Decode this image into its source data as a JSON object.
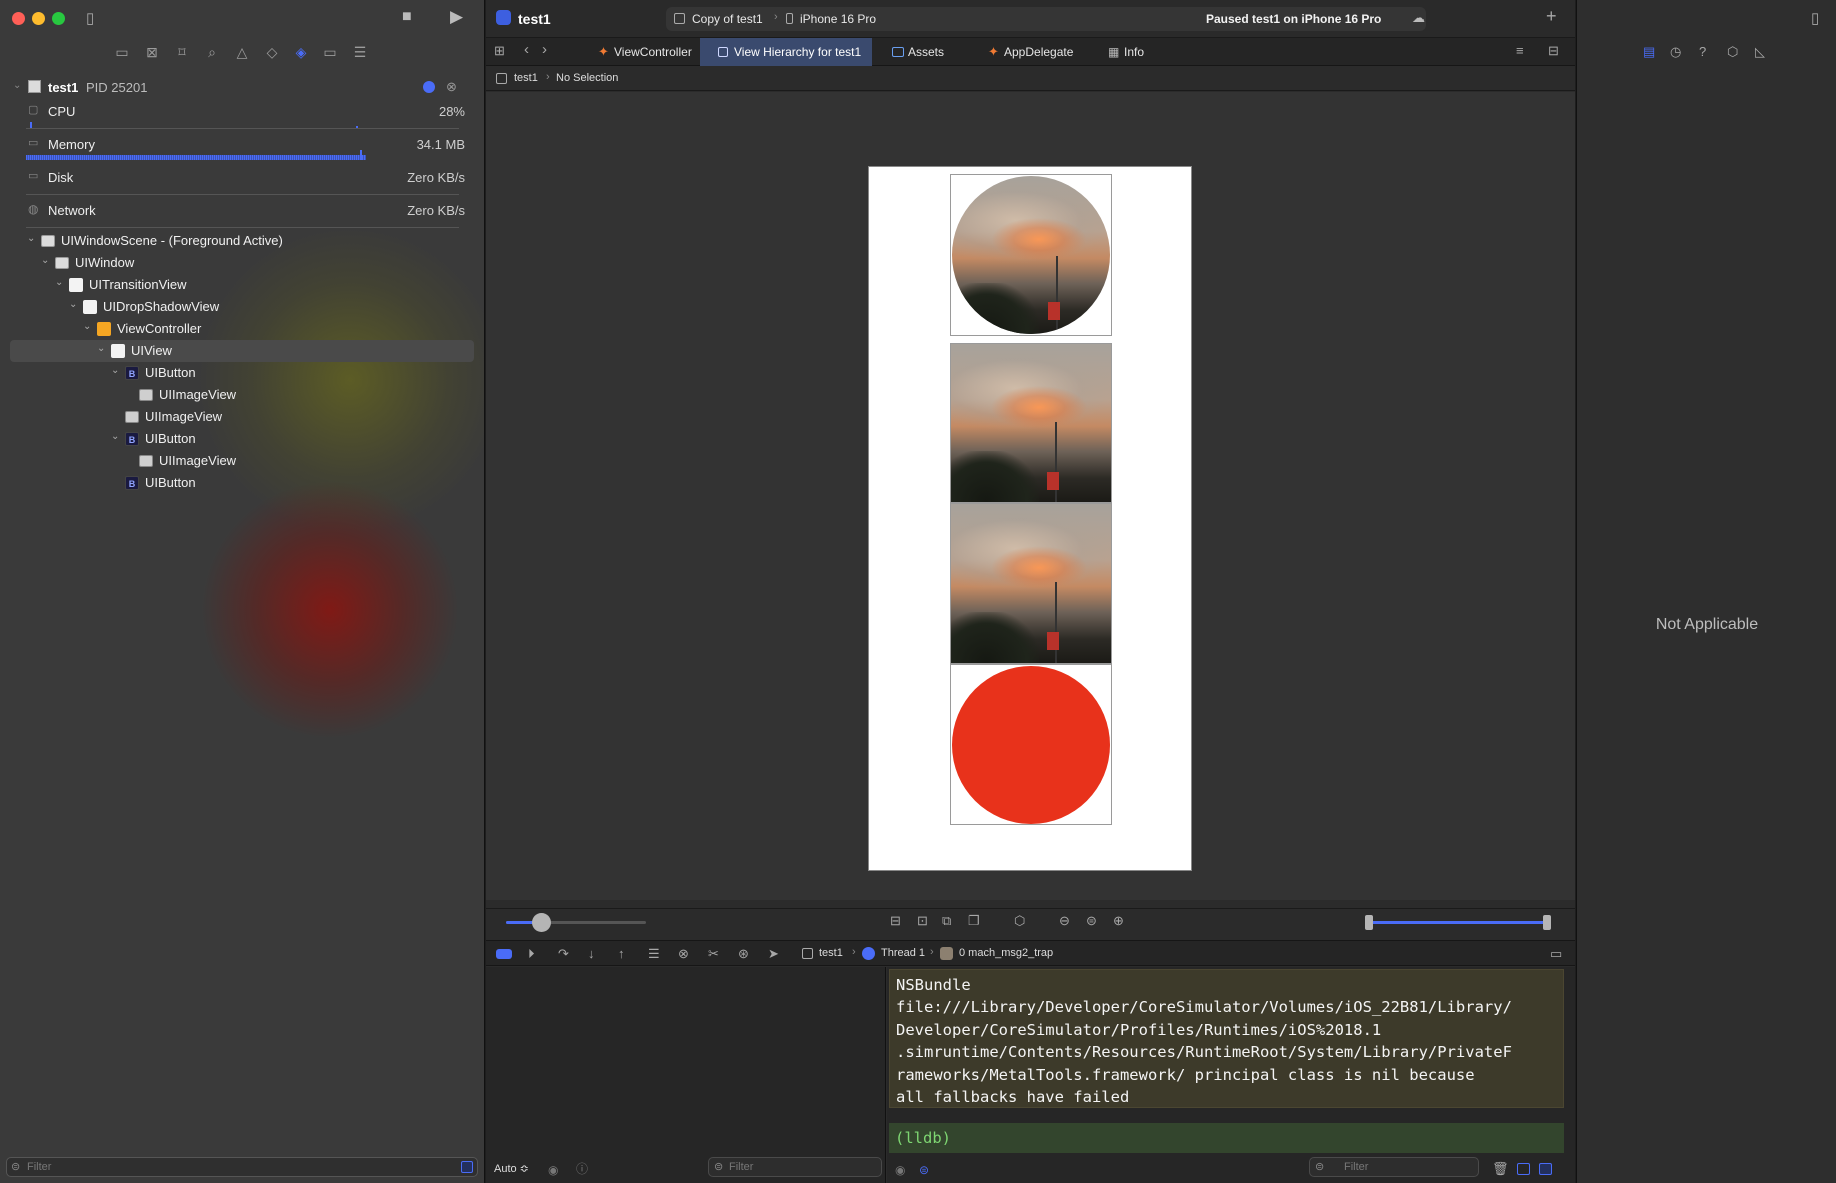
{
  "window": {
    "traffic_lights": [
      "#ff5f57",
      "#febc2e",
      "#28c840"
    ]
  },
  "toolbar": {
    "project_name": "test1",
    "scheme": "Copy of test1",
    "destination": "iPhone 16 Pro",
    "status": "Paused test1 on iPhone 16 Pro",
    "add_icon": "plus-icon"
  },
  "tabs": [
    {
      "label": "ViewController",
      "icon": "swift-icon"
    },
    {
      "label": "View Hierarchy for test1",
      "icon": "view-hierarchy-icon",
      "active": true
    },
    {
      "label": "Assets",
      "icon": "assets-icon"
    },
    {
      "label": "AppDelegate",
      "icon": "swift-icon"
    },
    {
      "label": "Info",
      "icon": "table-icon"
    }
  ],
  "jumpbar": {
    "project": "test1",
    "selection": "No Selection"
  },
  "process": {
    "name": "test1",
    "pid": "PID 25201"
  },
  "gauges": [
    {
      "label": "CPU",
      "value": "28%"
    },
    {
      "label": "Memory",
      "value": "34.1 MB"
    },
    {
      "label": "Disk",
      "value": "Zero KB/s"
    },
    {
      "label": "Network",
      "value": "Zero KB/s"
    }
  ],
  "hierarchy": [
    {
      "label": "UIWindowScene - (Foreground Active)",
      "depth": 0,
      "icon": "window-scene"
    },
    {
      "label": "UIWindow",
      "depth": 1,
      "icon": "window"
    },
    {
      "label": "UITransitionView",
      "depth": 2,
      "icon": "view"
    },
    {
      "label": "UIDropShadowView",
      "depth": 3,
      "icon": "view"
    },
    {
      "label": "ViewController",
      "depth": 4,
      "icon": "view-controller"
    },
    {
      "label": "UIView",
      "depth": 5,
      "icon": "view",
      "selected": true
    },
    {
      "label": "UIButton",
      "depth": 6,
      "icon": "button"
    },
    {
      "label": "UIImageView",
      "depth": 7,
      "icon": "image"
    },
    {
      "label": "UIImageView",
      "depth": 6,
      "icon": "image"
    },
    {
      "label": "UIButton",
      "depth": 6,
      "icon": "button"
    },
    {
      "label": "UIImageView",
      "depth": 7,
      "icon": "image"
    },
    {
      "label": "UIButton",
      "depth": 6,
      "icon": "button"
    }
  ],
  "filters": {
    "left": "Filter",
    "variables": "Filter",
    "console": "Filter"
  },
  "debug": {
    "process": "test1",
    "thread": "Thread 1",
    "frame": "0 mach_msg2_trap",
    "variables_mode": "Auto ≎",
    "console_message": "NSBundle\nfile:///Library/Developer/CoreSimulator/Volumes/iOS_22B81/Library/\nDeveloper/CoreSimulator/Profiles/Runtimes/iOS%2018.1\n.simruntime/Contents/Resources/RuntimeRoot/System/Library/PrivateF\nrameworks/MetalTools.framework/ principal class is nil because\nall fallbacks have failed",
    "prompt": "(lldb)"
  },
  "inspector": {
    "empty_label": "Not Applicable"
  },
  "colors": {
    "accent": "#4a6cf7",
    "selection_row": "#4a4a4a",
    "red_circle": "#e8321b",
    "console_bg": "#3d3a2a",
    "prompt_bg": "#33452d"
  }
}
